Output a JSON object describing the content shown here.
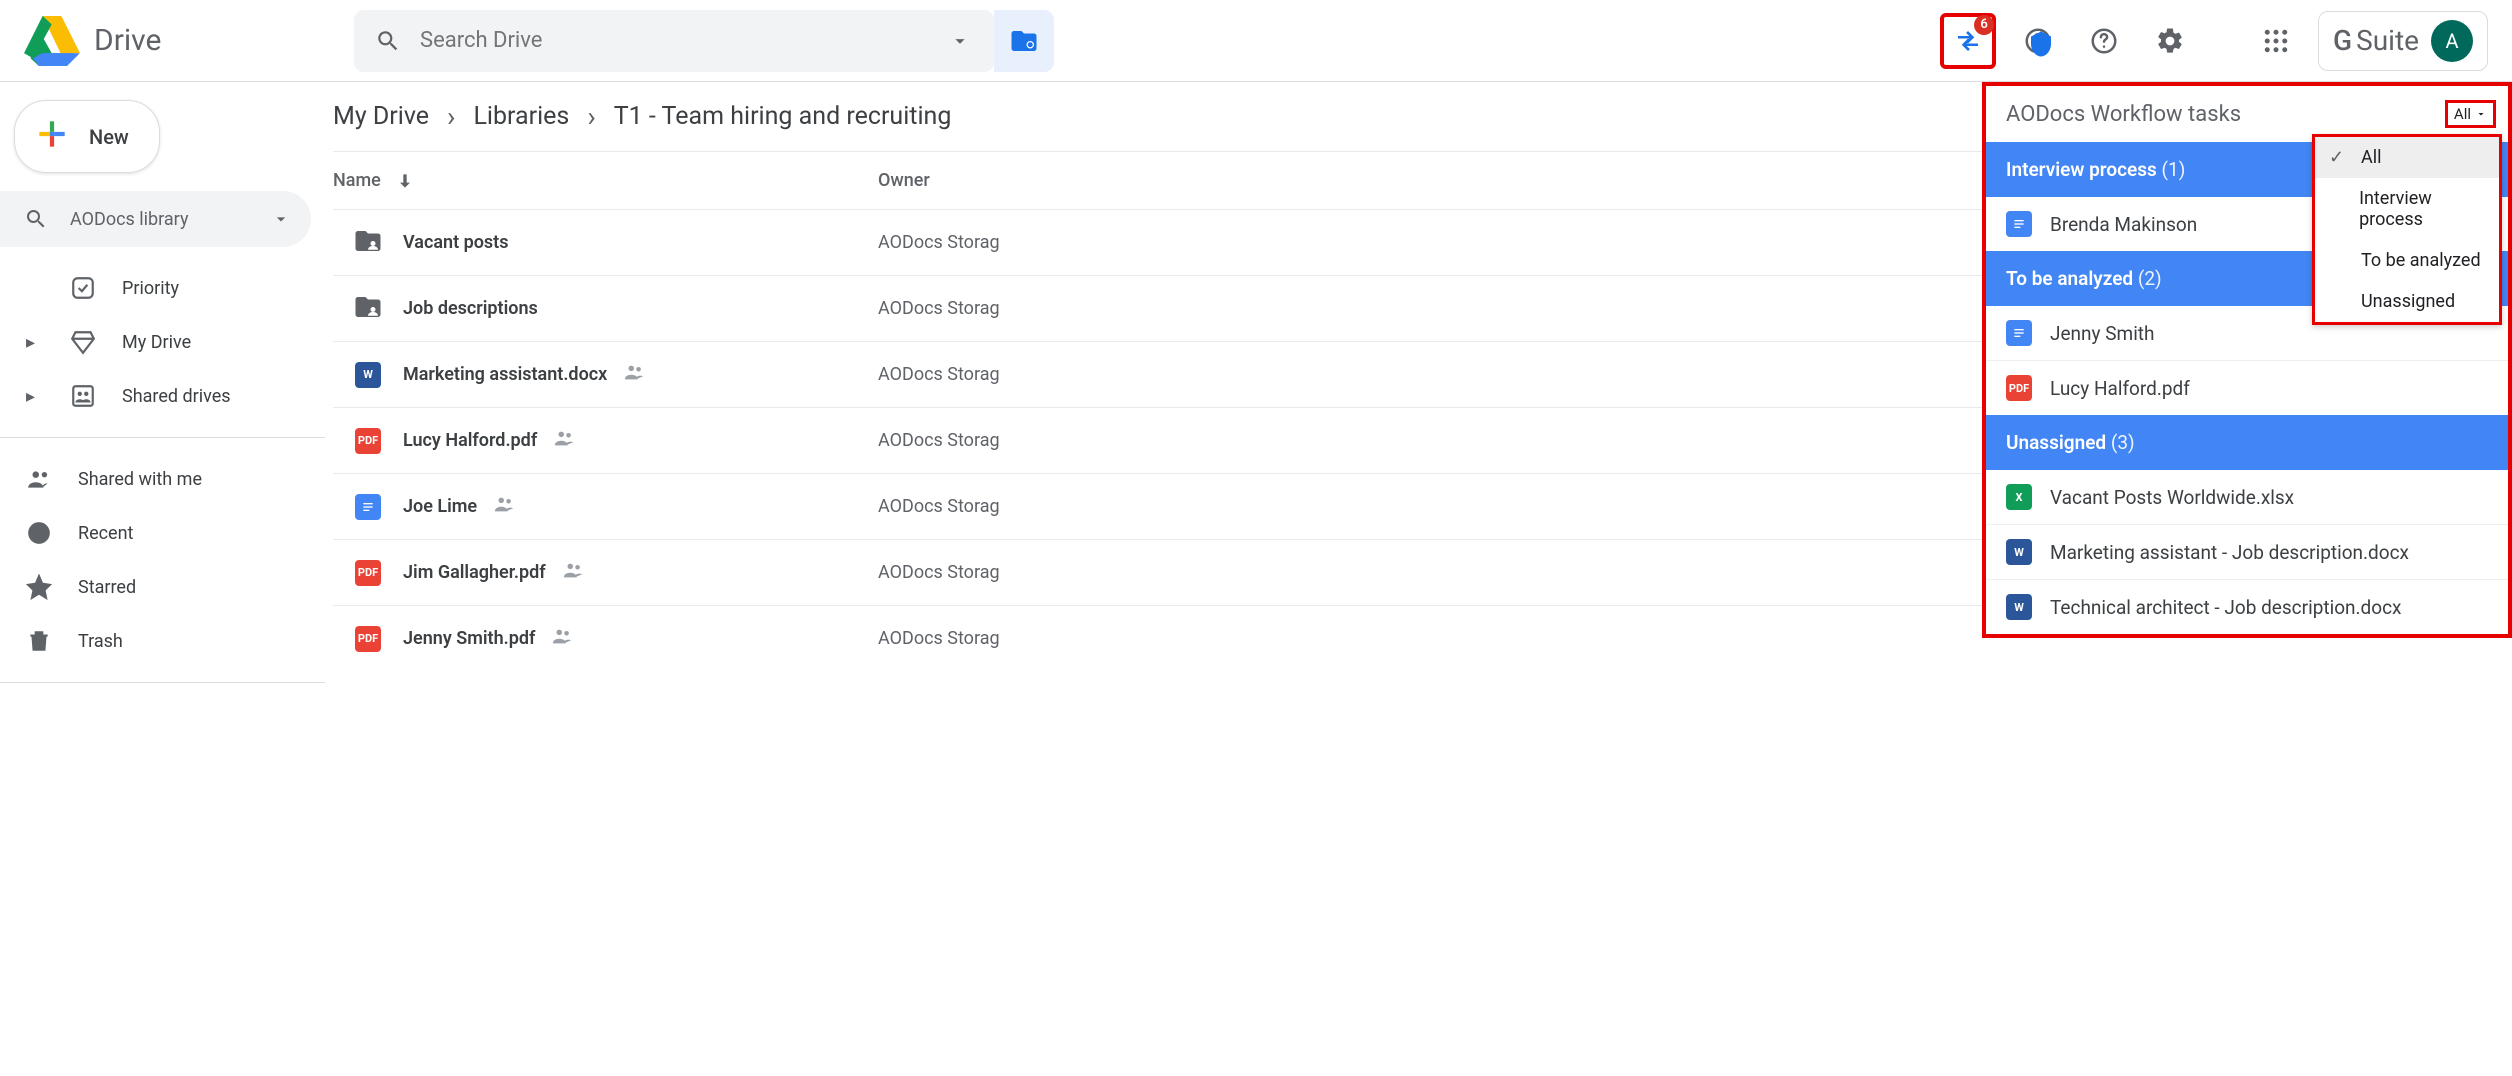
{
  "app": {
    "name": "Drive"
  },
  "search": {
    "placeholder": "Search Drive"
  },
  "header_icons": {
    "workflow_badge": "6",
    "suite_label": "G Suite",
    "avatar_initial": "A"
  },
  "sidebar": {
    "new_label": "New",
    "library_selector": "AODocs library",
    "groups": [
      {
        "items": [
          {
            "label": "Priority",
            "icon": "priority-icon",
            "expandable": false
          },
          {
            "label": "My Drive",
            "icon": "my-drive-icon",
            "expandable": true
          },
          {
            "label": "Shared drives",
            "icon": "shared-drives-icon",
            "expandable": true
          }
        ]
      },
      {
        "items": [
          {
            "label": "Shared with me",
            "icon": "shared-with-me-icon"
          },
          {
            "label": "Recent",
            "icon": "recent-icon"
          },
          {
            "label": "Starred",
            "icon": "starred-icon"
          },
          {
            "label": "Trash",
            "icon": "trash-icon"
          }
        ]
      }
    ]
  },
  "breadcrumbs": [
    "My Drive",
    "Libraries",
    "T1 - Team hiring and recruiting"
  ],
  "columns": {
    "name": "Name",
    "owner": "Owner"
  },
  "files": [
    {
      "icon": "folder",
      "name": "Vacant posts",
      "shared": false,
      "owner": "AODocs Storag"
    },
    {
      "icon": "folder",
      "name": "Job descriptions",
      "shared": false,
      "owner": "AODocs Storag"
    },
    {
      "icon": "word",
      "name": "Marketing assistant.docx",
      "shared": true,
      "owner": "AODocs Storag"
    },
    {
      "icon": "pdf",
      "name": "Lucy Halford.pdf",
      "shared": true,
      "owner": "AODocs Storag"
    },
    {
      "icon": "gdoc",
      "name": "Joe Lime",
      "shared": true,
      "owner": "AODocs Storag"
    },
    {
      "icon": "pdf",
      "name": "Jim Gallagher.pdf",
      "shared": true,
      "owner": "AODocs Storag"
    },
    {
      "icon": "pdf",
      "name": "Jenny Smith.pdf",
      "shared": true,
      "owner": "AODocs Storag"
    }
  ],
  "workflow": {
    "title": "AODocs Workflow tasks",
    "filter_label": "All",
    "filter_options": [
      "All",
      "Interview process",
      "To be analyzed",
      "Unassigned"
    ],
    "groups": [
      {
        "title": "Interview process",
        "count": 1,
        "items": [
          {
            "icon": "gdoc",
            "label": "Brenda Makinson"
          }
        ]
      },
      {
        "title": "To be analyzed",
        "count": 2,
        "items": [
          {
            "icon": "gdoc",
            "label": "Jenny Smith"
          },
          {
            "icon": "pdf",
            "label": "Lucy Halford.pdf"
          }
        ]
      },
      {
        "title": "Unassigned",
        "count": 3,
        "items": [
          {
            "icon": "xlsx",
            "label": "Vacant Posts Worldwide.xlsx"
          },
          {
            "icon": "word",
            "label": "Marketing assistant - Job description.docx"
          },
          {
            "icon": "word",
            "label": "Technical architect - Job description.docx"
          }
        ]
      }
    ]
  }
}
